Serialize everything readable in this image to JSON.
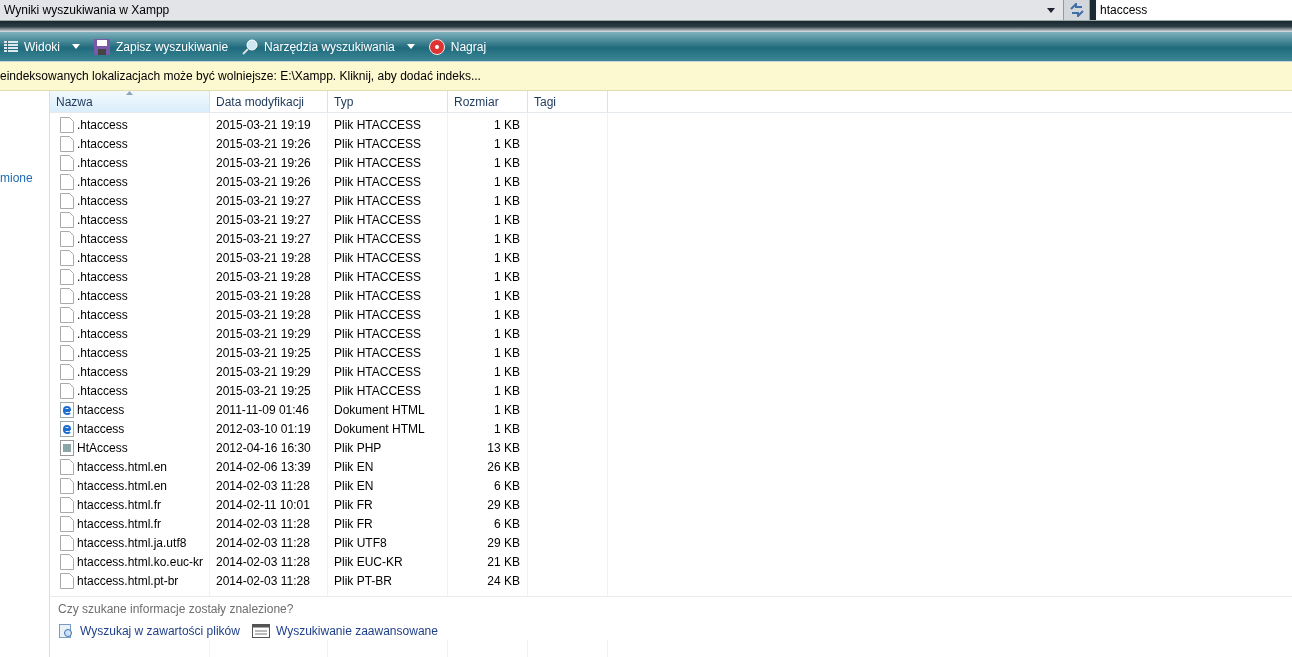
{
  "address_bar": {
    "title": "Wyniki wyszukiwania w Xampp"
  },
  "search": {
    "value": "htaccess"
  },
  "toolbar": [
    {
      "kind": "views",
      "label": "Widoki",
      "dropdown": true
    },
    {
      "kind": "save",
      "label": "Zapisz wyszukiwanie",
      "dropdown": false
    },
    {
      "kind": "tools",
      "label": "Narzędzia wyszukiwania",
      "dropdown": true
    },
    {
      "kind": "burn",
      "label": "Nagraj",
      "dropdown": false
    }
  ],
  "info_bar": "eindeksowanych lokalizacjach może być wolniejsze: E:\\Xampp. Kliknij, aby dodać indeks...",
  "sidebar": {
    "link": "mione"
  },
  "table": {
    "columns": [
      {
        "label": "Nazwa",
        "sorted": true
      },
      {
        "label": "Data modyfikacji",
        "sorted": false
      },
      {
        "label": "Typ",
        "sorted": false
      },
      {
        "label": "Rozmiar",
        "sorted": false
      },
      {
        "label": "Tagi",
        "sorted": false
      }
    ],
    "rows": [
      {
        "kind": "file",
        "name": ".htaccess",
        "date": "2015-03-21 19:19",
        "type": "Plik HTACCESS",
        "size": "1 KB"
      },
      {
        "kind": "file",
        "name": ".htaccess",
        "date": "2015-03-21 19:26",
        "type": "Plik HTACCESS",
        "size": "1 KB"
      },
      {
        "kind": "file",
        "name": ".htaccess",
        "date": "2015-03-21 19:26",
        "type": "Plik HTACCESS",
        "size": "1 KB"
      },
      {
        "kind": "file",
        "name": ".htaccess",
        "date": "2015-03-21 19:26",
        "type": "Plik HTACCESS",
        "size": "1 KB"
      },
      {
        "kind": "file",
        "name": ".htaccess",
        "date": "2015-03-21 19:27",
        "type": "Plik HTACCESS",
        "size": "1 KB"
      },
      {
        "kind": "file",
        "name": ".htaccess",
        "date": "2015-03-21 19:27",
        "type": "Plik HTACCESS",
        "size": "1 KB"
      },
      {
        "kind": "file",
        "name": ".htaccess",
        "date": "2015-03-21 19:27",
        "type": "Plik HTACCESS",
        "size": "1 KB"
      },
      {
        "kind": "file",
        "name": ".htaccess",
        "date": "2015-03-21 19:28",
        "type": "Plik HTACCESS",
        "size": "1 KB"
      },
      {
        "kind": "file",
        "name": ".htaccess",
        "date": "2015-03-21 19:28",
        "type": "Plik HTACCESS",
        "size": "1 KB"
      },
      {
        "kind": "file",
        "name": ".htaccess",
        "date": "2015-03-21 19:28",
        "type": "Plik HTACCESS",
        "size": "1 KB"
      },
      {
        "kind": "file",
        "name": ".htaccess",
        "date": "2015-03-21 19:28",
        "type": "Plik HTACCESS",
        "size": "1 KB"
      },
      {
        "kind": "file",
        "name": ".htaccess",
        "date": "2015-03-21 19:29",
        "type": "Plik HTACCESS",
        "size": "1 KB"
      },
      {
        "kind": "file",
        "name": ".htaccess",
        "date": "2015-03-21 19:25",
        "type": "Plik HTACCESS",
        "size": "1 KB"
      },
      {
        "kind": "file",
        "name": ".htaccess",
        "date": "2015-03-21 19:29",
        "type": "Plik HTACCESS",
        "size": "1 KB"
      },
      {
        "kind": "file",
        "name": ".htaccess",
        "date": "2015-03-21 19:25",
        "type": "Plik HTACCESS",
        "size": "1 KB"
      },
      {
        "kind": "html",
        "name": "htaccess",
        "date": "2011-11-09 01:46",
        "type": "Dokument HTML",
        "size": "1 KB"
      },
      {
        "kind": "html",
        "name": "htaccess",
        "date": "2012-03-10 01:19",
        "type": "Dokument HTML",
        "size": "1 KB"
      },
      {
        "kind": "php",
        "name": "HtAccess",
        "date": "2012-04-16 16:30",
        "type": "Plik PHP",
        "size": "13 KB"
      },
      {
        "kind": "file",
        "name": "htaccess.html.en",
        "date": "2014-02-06 13:39",
        "type": "Plik EN",
        "size": "26 KB"
      },
      {
        "kind": "file",
        "name": "htaccess.html.en",
        "date": "2014-02-03 11:28",
        "type": "Plik EN",
        "size": "6 KB"
      },
      {
        "kind": "file",
        "name": "htaccess.html.fr",
        "date": "2014-02-11 10:01",
        "type": "Plik FR",
        "size": "29 KB"
      },
      {
        "kind": "file",
        "name": "htaccess.html.fr",
        "date": "2014-02-03 11:28",
        "type": "Plik FR",
        "size": "6 KB"
      },
      {
        "kind": "file",
        "name": "htaccess.html.ja.utf8",
        "date": "2014-02-03 11:28",
        "type": "Plik UTF8",
        "size": "29 KB"
      },
      {
        "kind": "file",
        "name": "htaccess.html.ko.euc-kr",
        "date": "2014-02-03 11:28",
        "type": "Plik EUC-KR",
        "size": "21 KB"
      },
      {
        "kind": "file",
        "name": "htaccess.html.pt-br",
        "date": "2014-02-03 11:28",
        "type": "Plik PT-BR",
        "size": "24 KB"
      }
    ]
  },
  "footer": {
    "question": "Czy szukane informacje zostały znalezione?",
    "links": [
      {
        "kind": "content",
        "label": "Wyszukaj w zawartości plików"
      },
      {
        "kind": "advanced",
        "label": "Wyszukiwanie zaawansowane"
      }
    ]
  }
}
